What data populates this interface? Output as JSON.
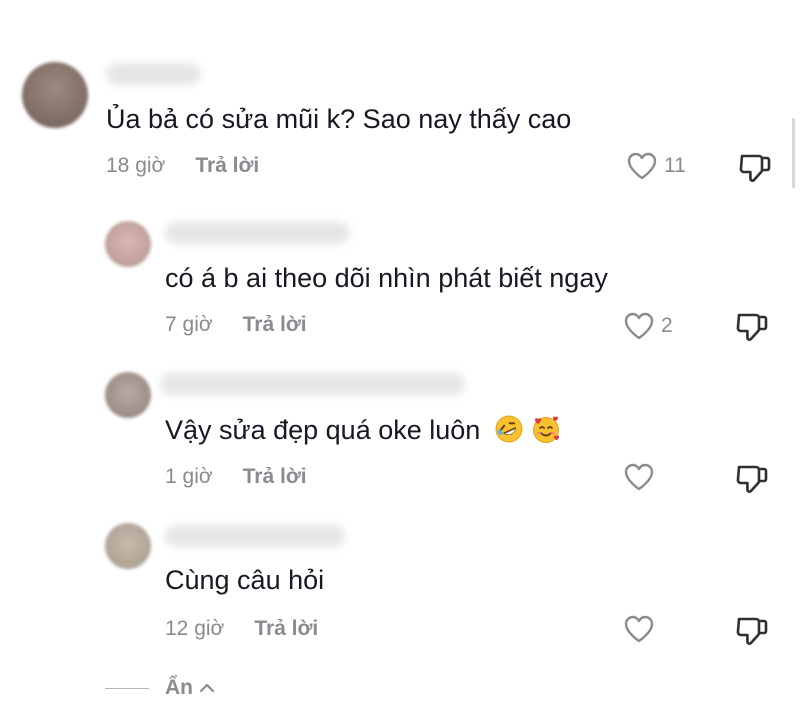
{
  "comments": [
    {
      "text": "Ủa bả có sửa mũi k? Sao nay thấy cao",
      "time": "18 giờ",
      "reply_label": "Trả lời",
      "likes": "11",
      "avatar_color": "#8c7a72"
    },
    {
      "text": "có á b ai theo dõi nhìn phát biết ngay",
      "time": "7 giờ",
      "reply_label": "Trả lời",
      "likes": "2",
      "avatar_color": "#c9a7a4"
    },
    {
      "text": "Vậy sửa đẹp quá oke luôn",
      "time": "1 giờ",
      "reply_label": "Trả lời",
      "likes": "",
      "emojis": [
        "rolling-on-floor-laughing-emoji",
        "smiling-face-with-hearts-emoji"
      ],
      "avatar_color": "#a49690"
    },
    {
      "text": "Cùng câu hỏi",
      "time": "12 giờ",
      "reply_label": "Trả lời",
      "likes": "",
      "avatar_color": "#b7a99a"
    }
  ],
  "collapse_label": "Ẩn",
  "icons": {
    "like": "heart-outline-icon",
    "dislike": "thumbs-down-icon",
    "collapse": "chevron-up-icon"
  },
  "colors": {
    "text": "#161823",
    "muted": "#8a8b91"
  }
}
